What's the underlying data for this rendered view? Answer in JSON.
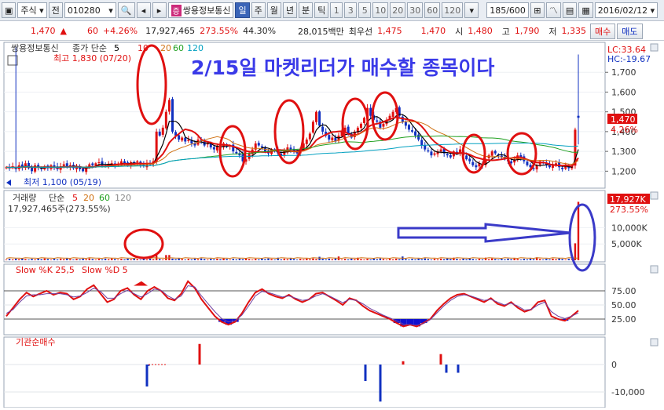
{
  "toolbar": {
    "market": "주식",
    "view_label": "전",
    "code": "010280",
    "badge": "증",
    "stock_name": "쌍용정보통신",
    "periods": [
      "일",
      "주",
      "월",
      "년",
      "분",
      "틱"
    ],
    "active_period": "일",
    "intervals": [
      "1",
      "3",
      "5",
      "10",
      "20",
      "30",
      "60",
      "120"
    ],
    "count": "185",
    "count_total": "/600",
    "date": "2016/02/12"
  },
  "quote": {
    "price": "1,470",
    "arrow": "▲",
    "change": "60",
    "change_pct": "+4.26%",
    "volume": "17,927,465",
    "volume_ratio": "273.55%",
    "turnover": "44.30%",
    "amount": "28,015백만",
    "priority_label": "최우선",
    "ask": "1,475",
    "bid": "1,470",
    "open_label": "시",
    "open": "1,480",
    "high_label": "고",
    "high": "1,790",
    "low_label": "저",
    "low": "1,335",
    "buy_label": "매수",
    "sell_label": "매도"
  },
  "panes": {
    "price": {
      "title": "쌍용정보통신",
      "ma_label": "종가 단순",
      "ma_periods": [
        "5",
        "10",
        "20",
        "60",
        "120"
      ],
      "annotation": "2/15일 마켓리더가 매수할 종목이다",
      "high_marker": "최고 1,830 (07/20)",
      "low_marker": "최저 1,100 (05/19)",
      "lc": "LC:33.64",
      "hc": "HC:-19.67",
      "current_label": "1,470",
      "current_pct": "4.26%"
    },
    "volume": {
      "title": "거래량",
      "ma_label": "단순",
      "ma_periods": [
        "5",
        "20",
        "60",
        "120"
      ],
      "sub": "17,927,465주(273.55%)",
      "current_label": "17,927K",
      "current_pct": "273.55%"
    },
    "stoch": {
      "title": "Slow %K 25,5",
      "title2": "Slow %D 5"
    },
    "inst": {
      "title": "기관순매수"
    }
  },
  "colors": {
    "up": "#e01010",
    "down": "#1030c0",
    "ma5": "#000000",
    "ma10": "#e01010",
    "ma20": "#d07010",
    "ma60": "#20a020",
    "ma120": "#00a0c0",
    "circle": "#e01010",
    "arrow": "#3a3ac8"
  },
  "chart_data": [
    {
      "type": "candlestick",
      "title": "쌍용정보통신",
      "ylim": [
        1100,
        1830
      ],
      "y_ticks": [
        1200,
        1300,
        1400,
        1500,
        1600,
        1700
      ],
      "y_tick_labels": [
        "1,200",
        "1,300",
        "1,400",
        "1,500",
        "1,600",
        "1,700"
      ],
      "highest": 1830,
      "lowest": 1100,
      "last_close": 1470,
      "last_open": 1480,
      "last_high": 1790,
      "last_low": 1335,
      "close_series": [
        1220,
        1215,
        1225,
        1210,
        1230,
        1220,
        1240,
        1215,
        1200,
        1230,
        1220,
        1210,
        1225,
        1215,
        1230,
        1220,
        1210,
        1225,
        1235,
        1220,
        1230,
        1215,
        1225,
        1210,
        1200,
        1220,
        1235,
        1230,
        1240,
        1245,
        1230,
        1225,
        1235,
        1240,
        1230,
        1235,
        1250,
        1240,
        1230,
        1245,
        1240,
        1250,
        1230,
        1225,
        1240,
        1235,
        1250,
        1400,
        1380,
        1420,
        1500,
        1560,
        1400,
        1380,
        1360,
        1370,
        1350,
        1360,
        1340,
        1330,
        1360,
        1350,
        1330,
        1340,
        1320,
        1310,
        1330,
        1320,
        1340,
        1325,
        1330,
        1300,
        1290,
        1280,
        1250,
        1260,
        1290,
        1310,
        1340,
        1330,
        1320,
        1300,
        1290,
        1310,
        1300,
        1290,
        1280,
        1300,
        1320,
        1310,
        1300,
        1290,
        1310,
        1340,
        1360,
        1390,
        1450,
        1500,
        1430,
        1400,
        1380,
        1360,
        1370,
        1350,
        1380,
        1400,
        1420,
        1390,
        1370,
        1400,
        1420,
        1440,
        1470,
        1520,
        1480,
        1460,
        1450,
        1420,
        1440,
        1460,
        1480,
        1500,
        1520,
        1480,
        1450,
        1430,
        1410,
        1400,
        1380,
        1360,
        1330,
        1310,
        1300,
        1280,
        1290,
        1300,
        1310,
        1290,
        1280,
        1270,
        1300,
        1290,
        1310,
        1280,
        1260,
        1250,
        1230,
        1220,
        1240,
        1230,
        1260,
        1280,
        1300,
        1290,
        1280,
        1270,
        1260,
        1250,
        1240,
        1260,
        1280,
        1270,
        1250,
        1230,
        1220,
        1210,
        1230,
        1250,
        1240,
        1230,
        1220,
        1230,
        1240,
        1220,
        1210,
        1230,
        1215,
        1225,
        1410,
        1470
      ]
    },
    {
      "type": "bar",
      "title": "거래량",
      "y_ticks": [
        5000,
        10000
      ],
      "y_tick_labels": [
        "5,000K",
        "10,000K"
      ],
      "last_value_k": 17927
    },
    {
      "type": "line",
      "title": "Slow %K 25,5 / Slow %D 5",
      "ylim": [
        0,
        100
      ],
      "y_ticks": [
        25,
        50,
        75
      ],
      "y_tick_labels": [
        "25.00",
        "50.00",
        "75.00"
      ],
      "series": [
        {
          "name": "Slow %K",
          "values": [
            30,
            45,
            60,
            72,
            65,
            70,
            75,
            68,
            72,
            70,
            60,
            65,
            78,
            85,
            70,
            55,
            60,
            75,
            80,
            68,
            60,
            75,
            82,
            75,
            62,
            58,
            70,
            92,
            80,
            60,
            45,
            30,
            20,
            15,
            20,
            35,
            55,
            72,
            78,
            70,
            65,
            62,
            68,
            60,
            55,
            60,
            70,
            72,
            65,
            58,
            50,
            62,
            58,
            48,
            40,
            35,
            30,
            25,
            18,
            12,
            15,
            12,
            18,
            25,
            40,
            52,
            62,
            68,
            70,
            65,
            60,
            55,
            62,
            52,
            48,
            55,
            45,
            38,
            42,
            55,
            58,
            30,
            25,
            22,
            30,
            40
          ]
        },
        {
          "name": "Slow %D",
          "values": [
            35,
            42,
            55,
            66,
            68,
            68,
            70,
            70,
            70,
            68,
            64,
            66,
            72,
            80,
            74,
            62,
            62,
            70,
            76,
            70,
            64,
            70,
            78,
            76,
            66,
            60,
            66,
            84,
            82,
            66,
            52,
            38,
            26,
            20,
            22,
            32,
            48,
            66,
            74,
            72,
            68,
            64,
            66,
            62,
            58,
            60,
            66,
            70,
            66,
            60,
            54,
            60,
            58,
            52,
            44,
            38,
            32,
            27,
            22,
            16,
            15,
            14,
            17,
            24,
            36,
            48,
            58,
            65,
            68,
            66,
            62,
            58,
            60,
            55,
            50,
            53,
            48,
            41,
            42,
            50,
            55,
            38,
            30,
            26,
            30,
            36
          ]
        }
      ]
    },
    {
      "type": "bar",
      "title": "기관순매수",
      "y_ticks": [
        -10000,
        0
      ],
      "y_tick_labels": [
        "-10,000",
        "0"
      ]
    }
  ]
}
